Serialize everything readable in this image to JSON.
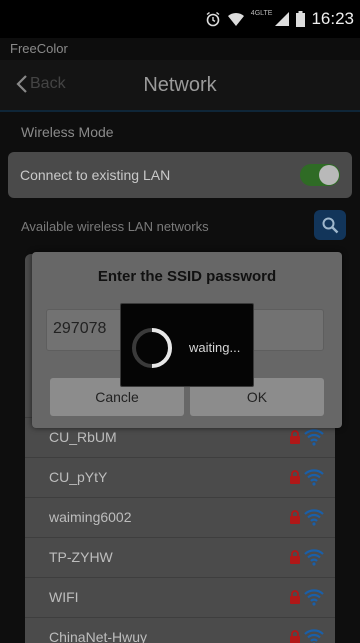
{
  "status_bar": {
    "time": "16:23",
    "network_badge": "4GLTE",
    "icons": [
      "alarm-icon",
      "wifi-icon",
      "signal-icon",
      "battery-icon"
    ]
  },
  "app": {
    "name": "FreeColor"
  },
  "nav": {
    "back_label": "Back",
    "title": "Network"
  },
  "wireless_mode": {
    "label": "Wireless Mode"
  },
  "lan_toggle": {
    "label": "Connect to existing LAN",
    "on": true
  },
  "available": {
    "label": "Available wireless LAN networks"
  },
  "networks": [
    {
      "ssid": "CU_RbUM"
    },
    {
      "ssid": "CU_pYtY"
    },
    {
      "ssid": "waiming6002"
    },
    {
      "ssid": "TP-ZYHW"
    },
    {
      "ssid": "WIFI"
    },
    {
      "ssid": "ChinaNet-Hwuy"
    }
  ],
  "dialog": {
    "title": "Enter the SSID password",
    "password_value": "297078",
    "cancel_label": "Cancle",
    "ok_label": "OK"
  },
  "waiting": {
    "label": "waiting..."
  },
  "colors": {
    "accent_blue": "#12355a",
    "toggle_green": "#2f6b25",
    "lock_red": "#b01818",
    "wifi_blue": "#1a5fa8"
  }
}
